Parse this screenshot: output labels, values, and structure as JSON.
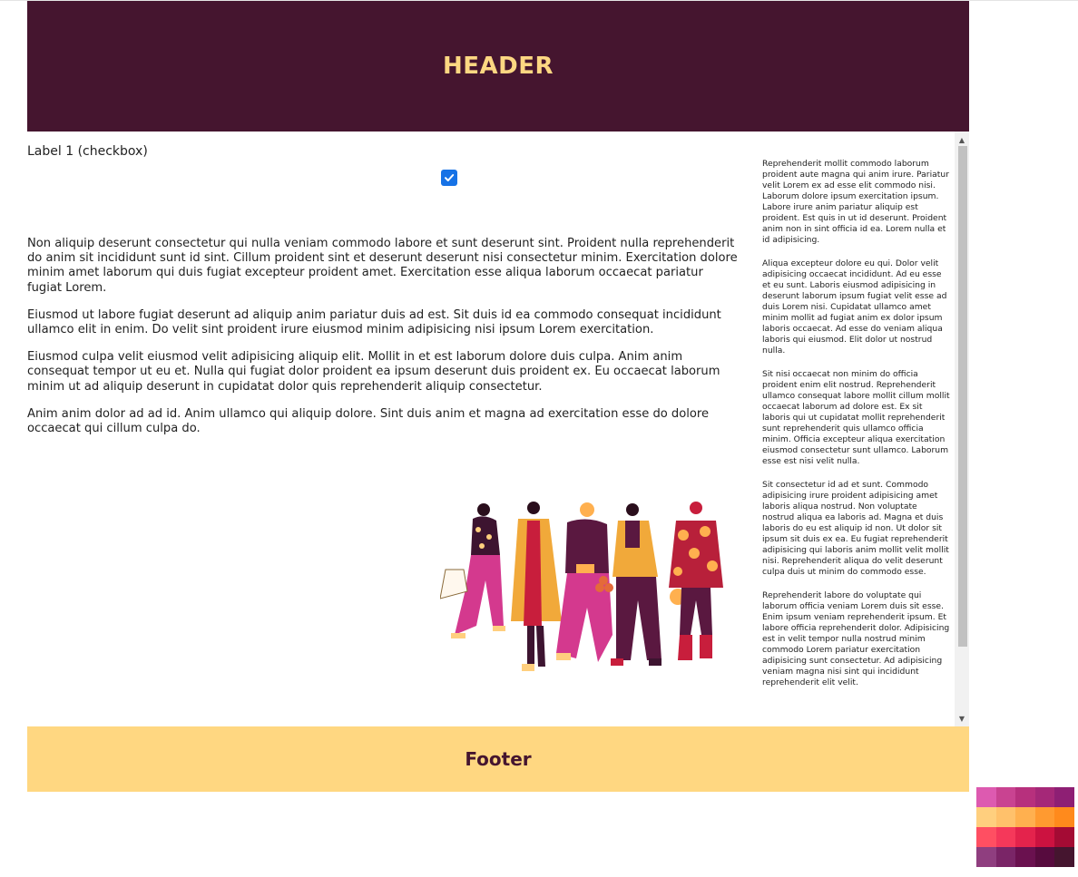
{
  "header": {
    "title": "HEADER"
  },
  "form": {
    "checkbox_label": "Label 1 (checkbox)",
    "checkbox_checked": true
  },
  "main": {
    "paragraphs": [
      "Non aliquip deserunt consectetur qui nulla veniam commodo labore et sunt deserunt sint. Proident nulla reprehenderit do anim sit incididunt sunt id sint. Cillum proident sint et deserunt deserunt nisi consectetur minim. Exercitation dolore minim amet laborum qui duis fugiat excepteur proident amet. Exercitation esse aliqua laborum occaecat pariatur fugiat Lorem.",
      "Eiusmod ut labore fugiat deserunt ad aliquip anim pariatur duis ad est. Sit duis id ea commodo consequat incididunt ullamco elit in enim. Do velit sint proident irure eiusmod minim adipisicing nisi ipsum Lorem exercitation.",
      "Eiusmod culpa velit eiusmod velit adipisicing aliquip elit. Mollit in et est laborum dolore duis culpa. Anim anim consequat tempor ut eu et. Nulla qui fugiat dolor proident ea ipsum deserunt duis proident ex. Eu occaecat laborum minim ut ad aliquip deserunt in cupidatat dolor quis reprehenderit aliquip consectetur.",
      "Anim anim dolor ad ad id. Anim ullamco qui aliquip dolore. Sint duis anim et magna ad exercitation esse do dolore occaecat qui cillum culpa do."
    ]
  },
  "aside": {
    "paragraphs": [
      "Reprehenderit mollit commodo laborum proident aute magna qui anim irure. Pariatur velit Lorem ex ad esse elit commodo nisi. Laborum dolore ipsum exercitation ipsum. Labore irure anim pariatur aliquip est proident. Est quis in ut id deserunt. Proident anim non in sint officia id ea. Lorem nulla et id adipisicing.",
      "Aliqua excepteur dolore eu qui. Dolor velit adipisicing occaecat incididunt. Ad eu esse et eu sunt. Laboris eiusmod adipisicing in deserunt laborum ipsum fugiat velit esse ad duis Lorem nisi. Cupidatat ullamco amet minim mollit ad fugiat anim ex dolor ipsum laboris occaecat. Ad esse do veniam aliqua laboris qui eiusmod. Elit dolor ut nostrud nulla.",
      "Sit nisi occaecat non minim do officia proident enim elit nostrud. Reprehenderit ullamco consequat labore mollit cillum mollit occaecat laborum ad dolore est. Ex sit laboris qui ut cupidatat mollit reprehenderit sunt reprehenderit quis ullamco officia minim. Officia excepteur aliqua exercitation eiusmod consectetur sunt ullamco. Laborum esse est nisi velit nulla.",
      "Sit consectetur id ad et sunt. Commodo adipisicing irure proident adipisicing amet laboris aliqua nostrud. Non voluptate nostrud aliqua ea laboris ad. Magna et duis laboris do eu est aliquip id non. Ut dolor sit ipsum sit duis ex ea. Eu fugiat reprehenderit adipisicing qui laboris anim mollit velit mollit nisi. Reprehenderit aliqua do velit deserunt culpa duis ut minim do commodo esse.",
      "Reprehenderit labore do voluptate qui laborum officia veniam Lorem duis sit esse. Enim ipsum veniam reprehenderit ipsum. Et labore officia reprehenderit dolor. Adipisicing est in velit tempor nulla nostrud minim commodo Lorem pariatur exercitation adipisicing sunt consectetur. Ad adipisicing veniam magna nisi sint qui incididunt reprehenderit elit velit."
    ]
  },
  "footer": {
    "title": "Footer"
  },
  "icons": {
    "checkmark": "checkmark-icon",
    "scroll_up": "scroll-up-arrow-icon",
    "scroll_down": "scroll-down-arrow-icon"
  },
  "colors": {
    "header_bg": "#45152f",
    "header_text": "#fdd782",
    "footer_bg": "#ffd781",
    "footer_text": "#45152f",
    "checkbox": "#1672e6"
  },
  "palette": [
    "#dd5ab0",
    "#c94391",
    "#b7307d",
    "#a52878",
    "#8e1f74",
    "#ffcf7e",
    "#ffc16b",
    "#ffb04f",
    "#ff9a30",
    "#ff8a1c",
    "#ff4f62",
    "#f5385a",
    "#e4234c",
    "#cc1240",
    "#a40b34",
    "#8f3e7f",
    "#7a2567",
    "#6a114f",
    "#570b3e",
    "#45152f"
  ]
}
